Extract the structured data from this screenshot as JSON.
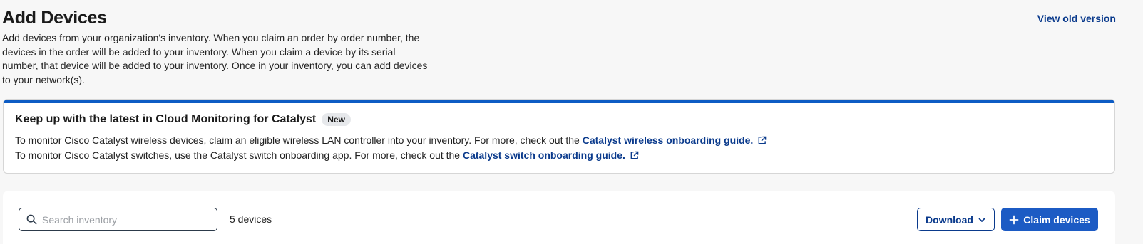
{
  "header": {
    "title": "Add Devices",
    "description": "Add devices from your organization's inventory. When you claim an order by order number, the devices in the order will be added to your inventory. When you claim a device by its serial number, that device will be added to your inventory. Once in your inventory, you can add devices to your network(s).",
    "view_old_label": "View old version"
  },
  "banner": {
    "title": "Keep up with the latest in Cloud Monitoring for Catalyst",
    "badge": "New",
    "line1_text": "To monitor Cisco Catalyst wireless devices, claim an eligible wireless LAN controller into your inventory. For more, check out the ",
    "line1_link": "Catalyst wireless onboarding guide.",
    "line2_text": "To monitor Cisco Catalyst switches, use the Catalyst switch onboarding app. For more, check out the ",
    "line2_link": "Catalyst switch onboarding guide."
  },
  "toolbar": {
    "search_placeholder": "Search inventory",
    "search_value": "",
    "device_count": "5 devices",
    "download_label": "Download",
    "claim_label": "Claim devices"
  },
  "colors": {
    "accent": "#1c5bc4",
    "link": "#0a3a8c",
    "banner_top": "#0d5cc4"
  },
  "icons": {
    "search": "search-icon",
    "external_link": "external-link-icon",
    "chevron": "chevron-down-icon",
    "plus": "plus-icon"
  }
}
